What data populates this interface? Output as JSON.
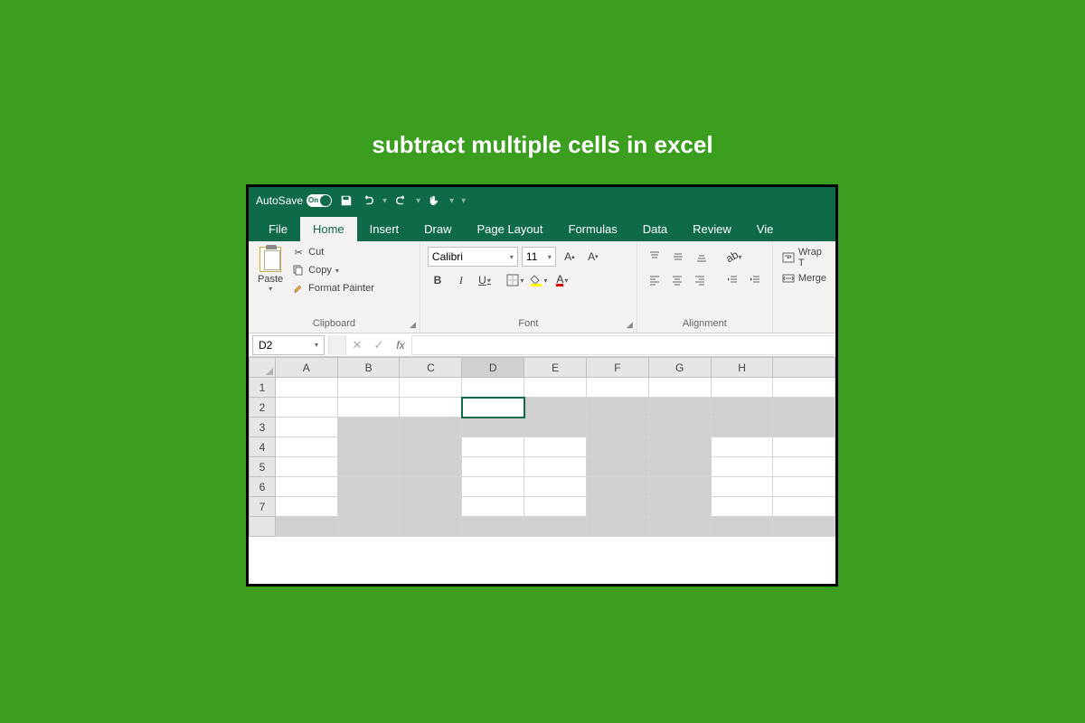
{
  "title": "subtract multiple cells in excel",
  "qat": {
    "autosave": "AutoSave",
    "autosave_state": "On"
  },
  "tabs": {
    "file": "File",
    "home": "Home",
    "insert": "Insert",
    "draw": "Draw",
    "page_layout": "Page Layout",
    "formulas": "Formulas",
    "data": "Data",
    "review": "Review",
    "view": "Vie"
  },
  "ribbon": {
    "clipboard": {
      "label": "Clipboard",
      "paste": "Paste",
      "cut": "Cut",
      "copy": "Copy",
      "format_painter": "Format Painter"
    },
    "font": {
      "label": "Font",
      "name": "Calibri",
      "size": "11",
      "bold": "B",
      "italic": "I",
      "underline": "U"
    },
    "alignment": {
      "label": "Alignment",
      "wrap": "Wrap T",
      "merge": "Merge"
    }
  },
  "formula_bar": {
    "name_box": "D2",
    "fx": "fx",
    "value": ""
  },
  "columns": [
    "A",
    "B",
    "C",
    "D",
    "E",
    "F",
    "G",
    "H"
  ],
  "rows": [
    "1",
    "2",
    "3",
    "4",
    "5",
    "6",
    "7"
  ]
}
